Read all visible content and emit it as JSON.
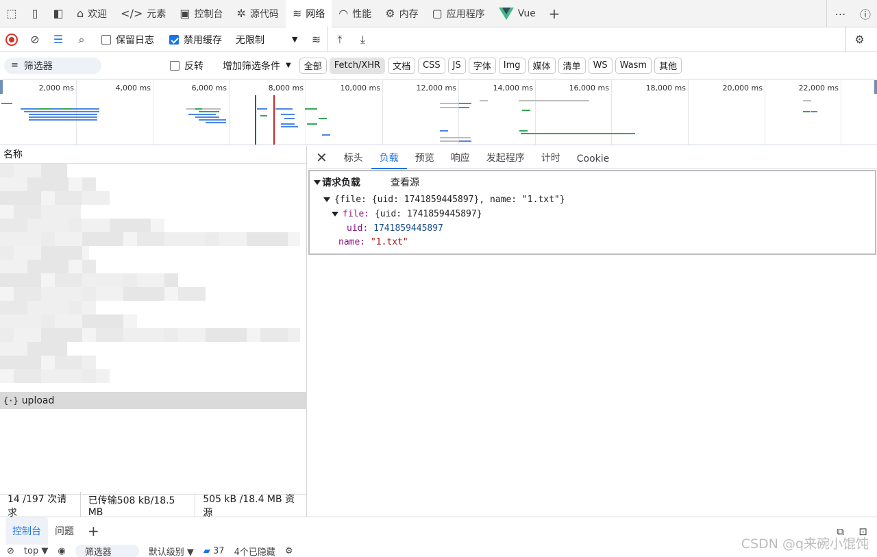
{
  "tabbar": {
    "tabs": [
      {
        "label": "欢迎",
        "icon": "home-icon"
      },
      {
        "label": "元素",
        "icon": "code-icon"
      },
      {
        "label": "控制台",
        "icon": "console-icon"
      },
      {
        "label": "源代码",
        "icon": "bug-icon"
      },
      {
        "label": "网络",
        "icon": "wifi-icon"
      },
      {
        "label": "性能",
        "icon": "gauge-icon"
      },
      {
        "label": "内存",
        "icon": "chip-icon"
      },
      {
        "label": "应用程序",
        "icon": "app-icon"
      },
      {
        "label": "Vue",
        "icon": "vue-logo"
      }
    ],
    "active_tab": "网络"
  },
  "toolbar": {
    "preserve_log_label": "保留日志",
    "disable_cache_label": "禁用缓存",
    "throttling_value": "无限制"
  },
  "filterbar": {
    "filter_placeholder": "筛选器",
    "invert_label": "反转",
    "more_filters_label": "增加筛选条件",
    "type_buttons": [
      "全部",
      "Fetch/XHR",
      "文档",
      "CSS",
      "JS",
      "字体",
      "Img",
      "媒体",
      "清单",
      "WS",
      "Wasm",
      "其他"
    ],
    "active_type": "Fetch/XHR"
  },
  "overview": {
    "ticks": [
      "2,000 ms",
      "4,000 ms",
      "6,000 ms",
      "8,000 ms",
      "10,000 ms",
      "12,000 ms",
      "14,000 ms",
      "16,000 ms",
      "18,000 ms",
      "20,000 ms",
      "22,000 ms"
    ],
    "colors": {
      "blue": "#4a86e8",
      "green": "#34a853",
      "gray": "#bdbdbd",
      "dom_content_loaded": "#1a56b0",
      "load": "#c62828"
    }
  },
  "requests": {
    "name_header": "名称",
    "selected_request": "upload"
  },
  "status": {
    "requests": "14 /197 次请求",
    "transferred": "已传输508 kB/18.5 MB",
    "resources": "505 kB /18.4 MB 资源"
  },
  "detail": {
    "tabs": [
      "标头",
      "负载",
      "预览",
      "响应",
      "发起程序",
      "计时",
      "Cookie"
    ],
    "active_tab": "负载",
    "section_title": "请求负载",
    "view_source_label": "查看源",
    "payload": {
      "summary": "{file: {uid: 1741859445897}, name: \"1.txt\"}",
      "file_key": "file:",
      "file_summary": "{uid: 1741859445897}",
      "uid_key": "uid:",
      "uid_value": "1741859445897",
      "name_key": "name:",
      "name_value": "\"1.txt\""
    }
  },
  "drawer": {
    "tabs": [
      "控制台",
      "问题"
    ],
    "active_tab": "控制台",
    "console_bar": {
      "context": "top",
      "filter_placeholder": "筛选器",
      "levels": "默认级别",
      "messages": "37",
      "hidden": "4个已隐藏"
    }
  },
  "watermark": "CSDN @q来碗小馄饨"
}
